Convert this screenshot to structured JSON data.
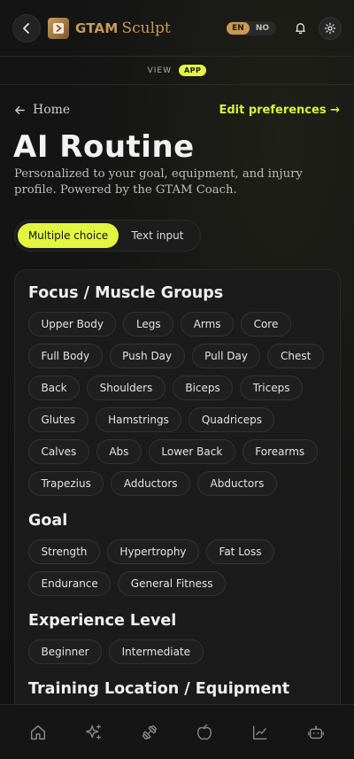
{
  "header": {
    "brand_bold": "GTAM",
    "brand_script": "Sculpt",
    "lang_on": "EN",
    "lang_off": "NO"
  },
  "view": {
    "label": "VIEW",
    "badge": "APP"
  },
  "nav": {
    "home": "Home",
    "edit": "Edit preferences →"
  },
  "page": {
    "title": "AI Routine",
    "subtitle": "Personalized to your goal, equipment, and injury profile. Powered by the GTAM Coach."
  },
  "mode": {
    "active": "Multiple choice",
    "inactive": "Text input"
  },
  "sections": {
    "focus": {
      "title": "Focus / Muscle Groups",
      "chips": [
        "Upper Body",
        "Legs",
        "Arms",
        "Core",
        "Full Body",
        "Push Day",
        "Pull Day",
        "Chest",
        "Back",
        "Shoulders",
        "Biceps",
        "Triceps",
        "Glutes",
        "Hamstrings",
        "Quadriceps",
        "Calves",
        "Abs",
        "Lower Back",
        "Forearms",
        "Trapezius",
        "Adductors",
        "Abductors"
      ]
    },
    "goal": {
      "title": "Goal",
      "chips": [
        "Strength",
        "Hypertrophy",
        "Fat Loss",
        "Endurance",
        "General Fitness"
      ]
    },
    "experience": {
      "title": "Experience Level",
      "chips": [
        "Beginner",
        "Intermediate"
      ]
    },
    "location": {
      "title": "Training Location / Equipment"
    }
  },
  "colors": {
    "accent": "#e2f540",
    "brand": "#c79a56",
    "background": "#141414"
  },
  "icons": {
    "topbar": [
      "back-arrow-icon",
      "logo-icon",
      "bell-icon",
      "gear-icon"
    ],
    "bottomnav": [
      "home-icon",
      "sparkles-icon",
      "dumbbell-icon",
      "apple-icon",
      "chart-line-icon",
      "robot-icon"
    ]
  }
}
